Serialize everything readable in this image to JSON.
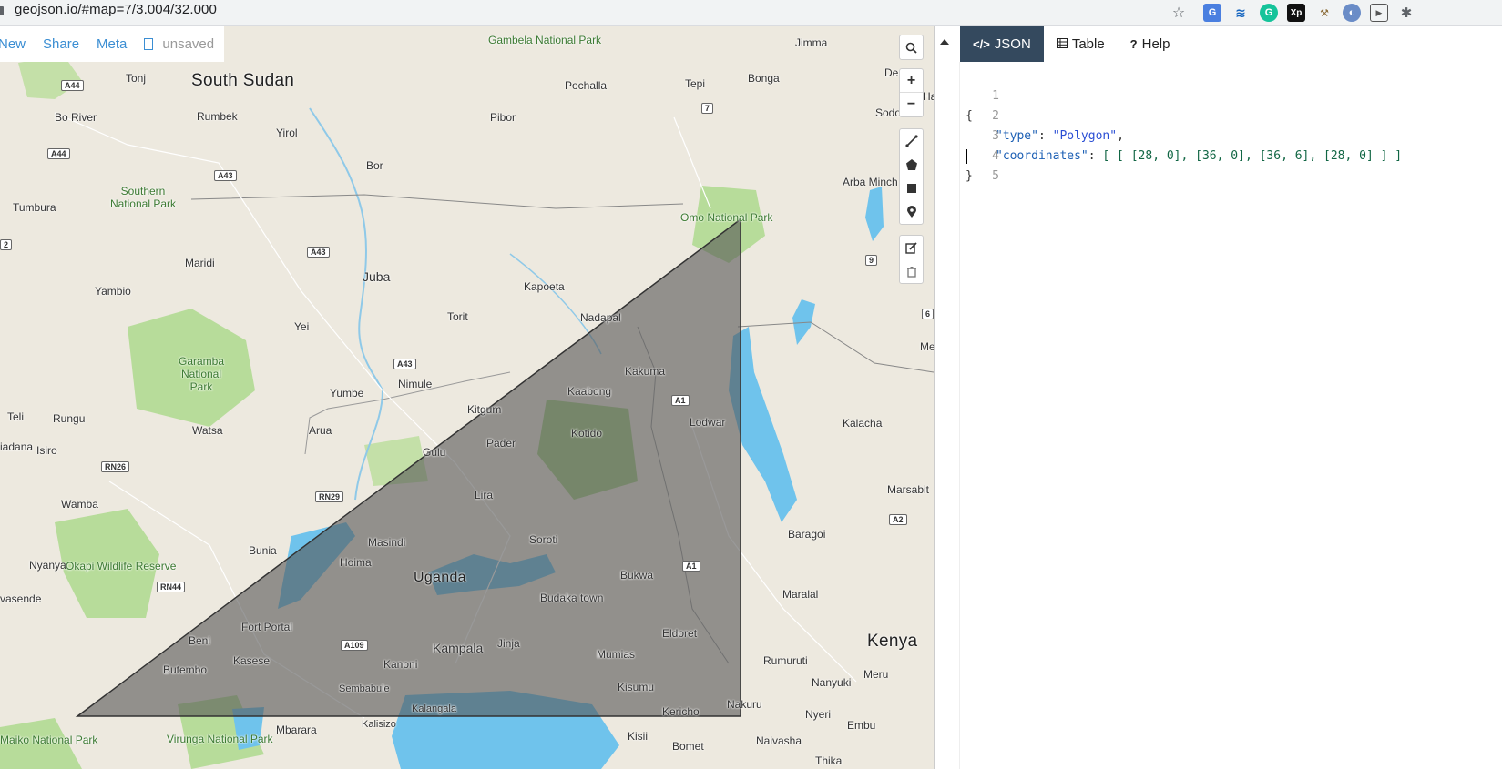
{
  "browser": {
    "url": "geojson.io/#map=7/3.004/32.000"
  },
  "toolbar": {
    "new_label": "New",
    "share_label": "Share",
    "meta_label": "Meta",
    "status_label": "unsaved"
  },
  "map": {
    "places": [
      {
        "name": "South Sudan",
        "kind": "country"
      },
      {
        "name": "Uganda",
        "kind": "country"
      },
      {
        "name": "Kenya",
        "kind": "country"
      },
      {
        "name": "Gambela National Park",
        "kind": "park"
      },
      {
        "name": "Southern National Park",
        "kind": "park"
      },
      {
        "name": "Garamba National Park",
        "kind": "park"
      },
      {
        "name": "Okapi Wildlife Reserve",
        "kind": "park"
      },
      {
        "name": "Omo National Park",
        "kind": "park"
      },
      {
        "name": "Virunga National Park",
        "kind": "park"
      },
      {
        "name": "Maiko National Park",
        "kind": "park"
      },
      {
        "name": "Jimma",
        "kind": "city"
      },
      {
        "name": "Bonga",
        "kind": "city"
      },
      {
        "name": "Tepi",
        "kind": "city"
      },
      {
        "name": "Pochalla",
        "kind": "city"
      },
      {
        "name": "Pibor",
        "kind": "city"
      },
      {
        "name": "Tonj",
        "kind": "city"
      },
      {
        "name": "Rumbek",
        "kind": "city"
      },
      {
        "name": "Bo River",
        "kind": "city"
      },
      {
        "name": "Yirol",
        "kind": "city"
      },
      {
        "name": "Bor",
        "kind": "city"
      },
      {
        "name": "Tumbura",
        "kind": "city"
      },
      {
        "name": "Maridi",
        "kind": "city"
      },
      {
        "name": "Yambio",
        "kind": "city"
      },
      {
        "name": "Juba",
        "kind": "city"
      },
      {
        "name": "Kapoeta",
        "kind": "city"
      },
      {
        "name": "Torit",
        "kind": "city"
      },
      {
        "name": "Nadapal",
        "kind": "city"
      },
      {
        "name": "Yei",
        "kind": "city"
      },
      {
        "name": "Yumbe",
        "kind": "city"
      },
      {
        "name": "Nimule",
        "kind": "city"
      },
      {
        "name": "Kakuma",
        "kind": "city"
      },
      {
        "name": "Kaabong",
        "kind": "city"
      },
      {
        "name": "Lodwar",
        "kind": "city"
      },
      {
        "name": "Kitgum",
        "kind": "city"
      },
      {
        "name": "Kotido",
        "kind": "city"
      },
      {
        "name": "Rungu",
        "kind": "city"
      },
      {
        "name": "Teli",
        "kind": "city"
      },
      {
        "name": "Watsa",
        "kind": "city"
      },
      {
        "name": "Arua",
        "kind": "city"
      },
      {
        "name": "Gulu",
        "kind": "city"
      },
      {
        "name": "Pader",
        "kind": "city"
      },
      {
        "name": "Isiro",
        "kind": "city"
      },
      {
        "name": "Wamba",
        "kind": "city"
      },
      {
        "name": "Lira",
        "kind": "city"
      },
      {
        "name": "Masindi",
        "kind": "city"
      },
      {
        "name": "Soroti",
        "kind": "city"
      },
      {
        "name": "Bunia",
        "kind": "city"
      },
      {
        "name": "Hoima",
        "kind": "city"
      },
      {
        "name": "Nyanya",
        "kind": "city"
      },
      {
        "name": "Bukwa",
        "kind": "city"
      },
      {
        "name": "Budaka town",
        "kind": "city"
      },
      {
        "name": "Fort Portal",
        "kind": "city"
      },
      {
        "name": "Beni",
        "kind": "city"
      },
      {
        "name": "Kasese",
        "kind": "city"
      },
      {
        "name": "Butembo",
        "kind": "city"
      },
      {
        "name": "Kanoni",
        "kind": "city"
      },
      {
        "name": "Kampala",
        "kind": "city"
      },
      {
        "name": "Jinja",
        "kind": "city"
      },
      {
        "name": "Mumias",
        "kind": "city"
      },
      {
        "name": "Eldoret",
        "kind": "city"
      },
      {
        "name": "Sembabule",
        "kind": "city"
      },
      {
        "name": "Kisumu",
        "kind": "city"
      },
      {
        "name": "Kalangala",
        "kind": "city"
      },
      {
        "name": "Kalisizo",
        "kind": "city"
      },
      {
        "name": "Mbarara",
        "kind": "city"
      },
      {
        "name": "Kericho",
        "kind": "city"
      },
      {
        "name": "Nakuru",
        "kind": "city"
      },
      {
        "name": "Kisii",
        "kind": "city"
      },
      {
        "name": "Bomet",
        "kind": "city"
      },
      {
        "name": "Naivasha",
        "kind": "city"
      },
      {
        "name": "Nyeri",
        "kind": "city"
      },
      {
        "name": "Embu",
        "kind": "city"
      },
      {
        "name": "Thika",
        "kind": "city"
      },
      {
        "name": "Meru",
        "kind": "city"
      },
      {
        "name": "Nanyuki",
        "kind": "city"
      },
      {
        "name": "Rumuruti",
        "kind": "city"
      },
      {
        "name": "Maralal",
        "kind": "city"
      },
      {
        "name": "Baragoi",
        "kind": "city"
      },
      {
        "name": "Marsabit",
        "kind": "city"
      },
      {
        "name": "Kalacha",
        "kind": "city"
      },
      {
        "name": "Arba Minch",
        "kind": "city"
      },
      {
        "name": "Sodo",
        "kind": "city"
      },
      {
        "name": "Dembi",
        "kind": "city"
      },
      {
        "name": "Ha",
        "kind": "city"
      },
      {
        "name": "Me",
        "kind": "city"
      },
      {
        "name": "iadana",
        "kind": "city"
      },
      {
        "name": "vasende",
        "kind": "city"
      }
    ],
    "roads": [
      "A44",
      "A44",
      "A43",
      "A43",
      "A43",
      "7",
      "9",
      "6",
      "2",
      "A1",
      "A1",
      "A2",
      "RN26",
      "RN29",
      "RN44",
      "A109"
    ]
  },
  "map_controls": {
    "search_icon": "search-icon",
    "zoom_in": "+",
    "zoom_out": "−"
  },
  "panel": {
    "tabs": [
      {
        "label": "JSON",
        "icon": "</>",
        "active": true
      },
      {
        "label": "Table",
        "icon": "table-icon",
        "active": false
      },
      {
        "label": "Help",
        "icon": "?",
        "active": false
      }
    ],
    "editor": {
      "line_numbers": [
        "1",
        "2",
        "3",
        "4",
        "5"
      ],
      "lines": {
        "l1": "{",
        "l2_key": "\"type\"",
        "l2_val": "\"Polygon\"",
        "l3_key": "\"coordinates\"",
        "l3_val": "[ [ [28, 0], [36, 0], [36, 6], [28, 0] ] ]",
        "l4": "}",
        "l5": ""
      }
    }
  },
  "colors": {
    "tab_active": "#34495e",
    "link": "#3b8ed3",
    "polygon_fill": "#555555",
    "water": "#6fc3ec",
    "park": "#b7dc9a"
  }
}
